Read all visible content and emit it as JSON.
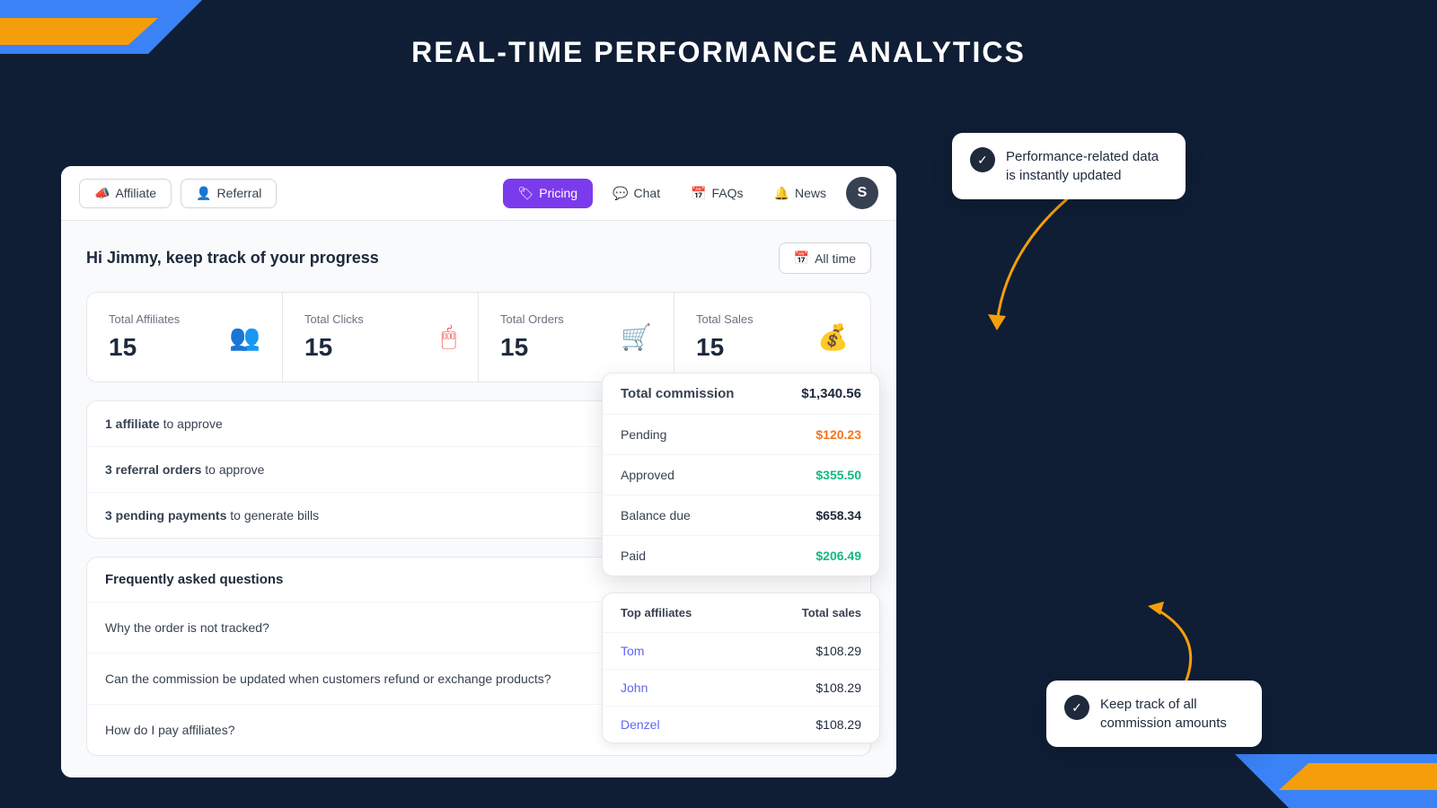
{
  "page": {
    "title": "REAL-TIME PERFORMANCE ANALYTICS"
  },
  "nav": {
    "affiliate_label": "Affiliate",
    "referral_label": "Referral",
    "pricing_label": "Pricing",
    "chat_label": "Chat",
    "faqs_label": "FAQs",
    "news_label": "News",
    "avatar_label": "S",
    "alltime_label": "All time"
  },
  "greeting": {
    "text": "Hi Jimmy, keep track of your progress"
  },
  "stats": [
    {
      "label": "Total Affiliates",
      "value": "15",
      "icon": "👥"
    },
    {
      "label": "Total Clicks",
      "value": "15",
      "icon": "🖱"
    },
    {
      "label": "Total Orders",
      "value": "15",
      "icon": "🛒"
    },
    {
      "label": "Total Sales",
      "value": "15",
      "icon": "💰"
    }
  ],
  "actions": [
    {
      "bold": "1 affiliate",
      "rest": " to approve"
    },
    {
      "bold": "3 referral orders",
      "rest": " to approve"
    },
    {
      "bold": "3 pending payments",
      "rest": " to generate bills"
    }
  ],
  "faq": {
    "title": "Frequently asked questions",
    "items": [
      "Why the order is not tracked?",
      "Can the commission be updated when customers refund or exchange products?",
      "How do I pay affiliates?"
    ]
  },
  "commission": {
    "rows": [
      {
        "label": "Total commission",
        "value": "$1,340.56",
        "type": "normal"
      },
      {
        "label": "Pending",
        "value": "$120.23",
        "type": "orange"
      },
      {
        "label": "Approved",
        "value": "$355.50",
        "type": "green"
      },
      {
        "label": "Balance due",
        "value": "$658.34",
        "type": "normal"
      },
      {
        "label": "Paid",
        "value": "$206.49",
        "type": "green"
      }
    ]
  },
  "affiliates_table": {
    "col1": "Top affiliates",
    "col2": "Total sales",
    "rows": [
      {
        "name": "Tom",
        "sales": "$108.29"
      },
      {
        "name": "John",
        "sales": "$108.29"
      },
      {
        "name": "Denzel",
        "sales": "$108.29"
      }
    ]
  },
  "tooltips": [
    {
      "text": "Performance-related data is instantly updated"
    },
    {
      "text": "Keep track of all commission amounts"
    }
  ]
}
